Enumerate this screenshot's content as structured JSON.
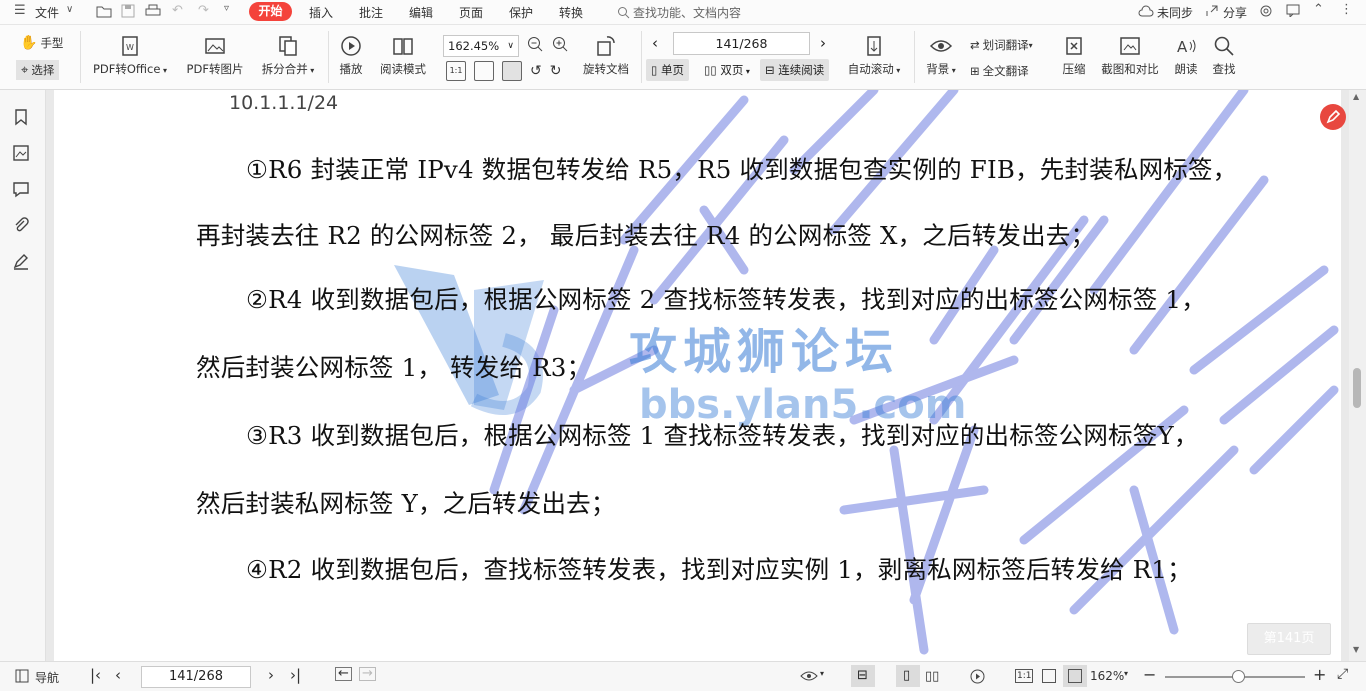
{
  "menubar": {
    "file": "文件",
    "tabs": [
      "开始",
      "插入",
      "批注",
      "编辑",
      "页面",
      "保护",
      "转换"
    ],
    "search_placeholder": "查找功能、文档内容",
    "sync": "未同步",
    "share": "分享"
  },
  "ribbon": {
    "hand": "手型",
    "select": "选择",
    "pdf_to_office": "PDF转Office",
    "pdf_to_image": "PDF转图片",
    "split_merge": "拆分合并",
    "play": "播放",
    "read_mode": "阅读模式",
    "zoom": "162.45%",
    "rotate": "旋转文档",
    "page_value": "141/268",
    "single": "单页",
    "double": "双页",
    "continuous": "连续阅读",
    "auto_scroll": "自动滚动",
    "background": "背景",
    "word_translate": "划词翻译",
    "full_translate": "全文翻译",
    "compress": "压缩",
    "screenshot_compare": "截图和对比",
    "read_aloud": "朗读",
    "find": "查找"
  },
  "document": {
    "crumb": "10.1.1.1/24",
    "lines": [
      "①R6 封装正常 IPv4 数据包转发给 R5，R5 收到数据包查实例的 FIB，先封装私网标签，",
      "再封装去往 R2 的公网标签 2，  最后封装去往 R4 的公网标签 X，之后转发出去；",
      "②R4 收到数据包后，根据公网标签 2 查找标签转发表，找到对应的出标签公网标签 1，",
      "然后封装公网标签 1，  转发给 R3；",
      "③R3 收到数据包后，根据公网标签 1 查找标签转发表，找到对应的出标签公网标签Y，",
      "然后封装私网标签 Y，之后转发出去；",
      "④R2 收到数据包后，查找标签转发表，找到对应实例 1，剥离私网标签后转发给 R1；"
    ],
    "watermark_cn": "攻城狮论坛",
    "watermark_url": "bbs.ylan5.com",
    "page_badge": "第141页"
  },
  "statusbar": {
    "nav": "导航",
    "page_value": "141/268",
    "zoom": "162%"
  }
}
